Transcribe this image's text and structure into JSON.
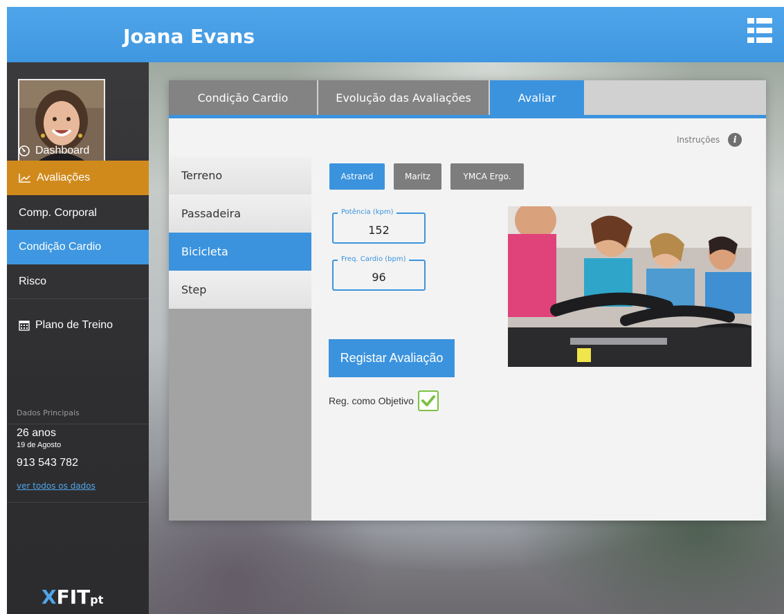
{
  "user": {
    "name": "Joana Evans"
  },
  "sidebar": {
    "items": [
      {
        "label": "Dashboard",
        "icon": "dashboard-icon"
      },
      {
        "label": "Avaliações",
        "icon": "chart-icon"
      },
      {
        "label": "Comp. Corporal"
      },
      {
        "label": "Condição Cardio"
      },
      {
        "label": "Risco"
      },
      {
        "label": "Plano de Treino",
        "icon": "calendar-icon"
      }
    ],
    "section_title": "Dados Principais",
    "age": "26 anos",
    "birthday": "19 de Agosto",
    "phone": "913 543 782",
    "see_all_link": "ver todos os dados"
  },
  "logo": {
    "x": "X",
    "fit": "FIT",
    "pt": "pt"
  },
  "tabs": [
    {
      "label": "Condição Cardio"
    },
    {
      "label": "Evolução das Avaliações"
    },
    {
      "label": "Avaliar",
      "active": true
    }
  ],
  "instructions_label": "Instruções",
  "subnav": [
    {
      "label": "Terreno"
    },
    {
      "label": "Passadeira"
    },
    {
      "label": "Bicicleta",
      "active": true
    },
    {
      "label": "Step"
    }
  ],
  "protocols": [
    {
      "label": "Astrand",
      "active": true
    },
    {
      "label": "Maritz"
    },
    {
      "label": "YMCA Ergo."
    }
  ],
  "fields": {
    "potencia": {
      "label": "Potência (kpm)",
      "value": "152"
    },
    "freq": {
      "label": "Freq. Cardio (bpm)",
      "value": "96"
    }
  },
  "register_button": "Registar Avaliação",
  "objective_label": "Reg. como Objetivo",
  "objective_checked": true,
  "colors": {
    "accent_blue": "#3b93de",
    "accent_orange": "#d08a1c",
    "check_green": "#7dc043"
  }
}
